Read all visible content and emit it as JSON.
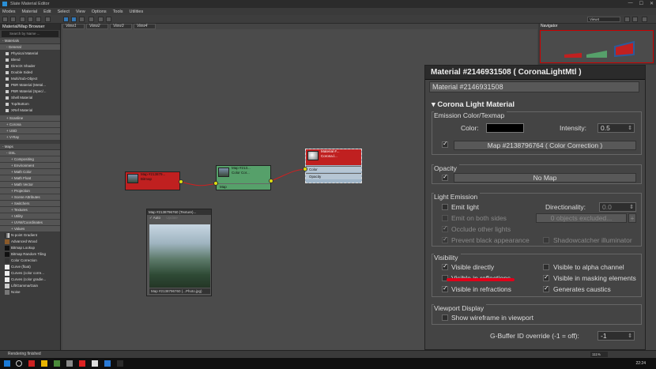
{
  "window": {
    "title": "Slate Material Editor"
  },
  "menu": [
    "Modes",
    "Material",
    "Edit",
    "Select",
    "View",
    "Options",
    "Tools",
    "Utilities"
  ],
  "toolbar": {
    "view_select": "View4"
  },
  "browser": {
    "title": "Material/Map Browser",
    "search_placeholder": "Search by Name ...",
    "materials_label": "- Materials",
    "general_label": "- General",
    "general_items": [
      "Physical Material",
      "Blend",
      "DirectX Shader",
      "Double Sided",
      "Multi/Sub-Object",
      "PBR Material (Metal...",
      "PBR Material (Spec/...",
      "Shell Material",
      "Top/Bottom",
      "XRef Material"
    ],
    "material_groups": [
      "+ Scanline",
      "+ Corona",
      "+ USD",
      "+ V-Ray"
    ],
    "maps_label": "- Maps",
    "osl_label": "- OSL",
    "osl_items": [
      "+ Compositing",
      "+ Environment",
      "+ Math Color",
      "+ Math Float",
      "+ Math Vector",
      "+ Projection",
      "+ Scene Attributes",
      "+ Switchers",
      "+ Textures",
      "+ Utility",
      "+ UVW/Coordinates",
      "+ Values"
    ],
    "map_items": [
      "N-point Gradient",
      "Advanced Wood",
      "Bitmap Lookup",
      "Bitmap Random Tiling",
      "Color Correction",
      "Curve (float)",
      "Curves (color corre...",
      "Curves (color gradie...",
      "Lift/Gamma/Gain",
      "Noise"
    ]
  },
  "view_tabs": [
    "View1",
    "View2",
    "View3",
    "View4"
  ],
  "navigator": {
    "title": "Navigator"
  },
  "nodes": {
    "bitmap": {
      "title": "Map #213879...",
      "sub": "Bitmap"
    },
    "colorcorr": {
      "title": "Map #213...",
      "sub": "Color Cor...",
      "slot": "Map"
    },
    "material": {
      "title": "Material #...",
      "sub": "Corona.l...",
      "slots": [
        "Color",
        "Opacity"
      ]
    }
  },
  "preview": {
    "title": "Map #2138796760 (Texture)...",
    "auto_label": "Auto",
    "update_label": "Update",
    "footer": "Map #2138796760 (...Photo.jpg)"
  },
  "panel": {
    "title": "Material #2146931508  ( CoronaLightMtl )",
    "name": "Material #2146931508",
    "rollout": "Corona Light Material",
    "emission": {
      "label": "Emission Color/Texmap",
      "color_label": "Color:",
      "intensity_label": "Intensity:",
      "intensity_value": "0.5",
      "map_button": "Map #2138796764  ( Color Correction )"
    },
    "opacity": {
      "label": "Opacity",
      "map_button": "No Map"
    },
    "light_emission": {
      "label": "Light Emission",
      "emit_light": "Emit light",
      "directionality_label": "Directionality:",
      "directionality_value": "0.0",
      "emit_both": "Emit on both sides",
      "objects_excluded": "0 objects excluded...",
      "plus": "+",
      "occlude": "Occlude other lights",
      "prevent_black": "Prevent black appearance",
      "shadowcatcher": "Shadowcatcher illuminator"
    },
    "visibility": {
      "label": "Visibility",
      "visible_directly": "Visible directly",
      "visible_alpha": "Visible to alpha channel",
      "visible_reflections": "Visible in reflections",
      "visible_masking": "Visible in masking elements",
      "visible_refractions": "Visible in refractions",
      "generates_caustics": "Generates caustics"
    },
    "viewport": {
      "label": "Viewport Display",
      "show_wireframe": "Show wireframe in viewport"
    },
    "gbuffer": {
      "label": "G-Buffer ID override (-1 = off):",
      "value": "-1"
    }
  },
  "status": {
    "text": "Rendering finished",
    "zoom": "111%"
  },
  "taskbar": {
    "time": "22:24"
  },
  "colors": {
    "highlight": "#e0001a",
    "node_green": "#56a06a",
    "node_red": "#c02020",
    "port": "#dddd11"
  }
}
